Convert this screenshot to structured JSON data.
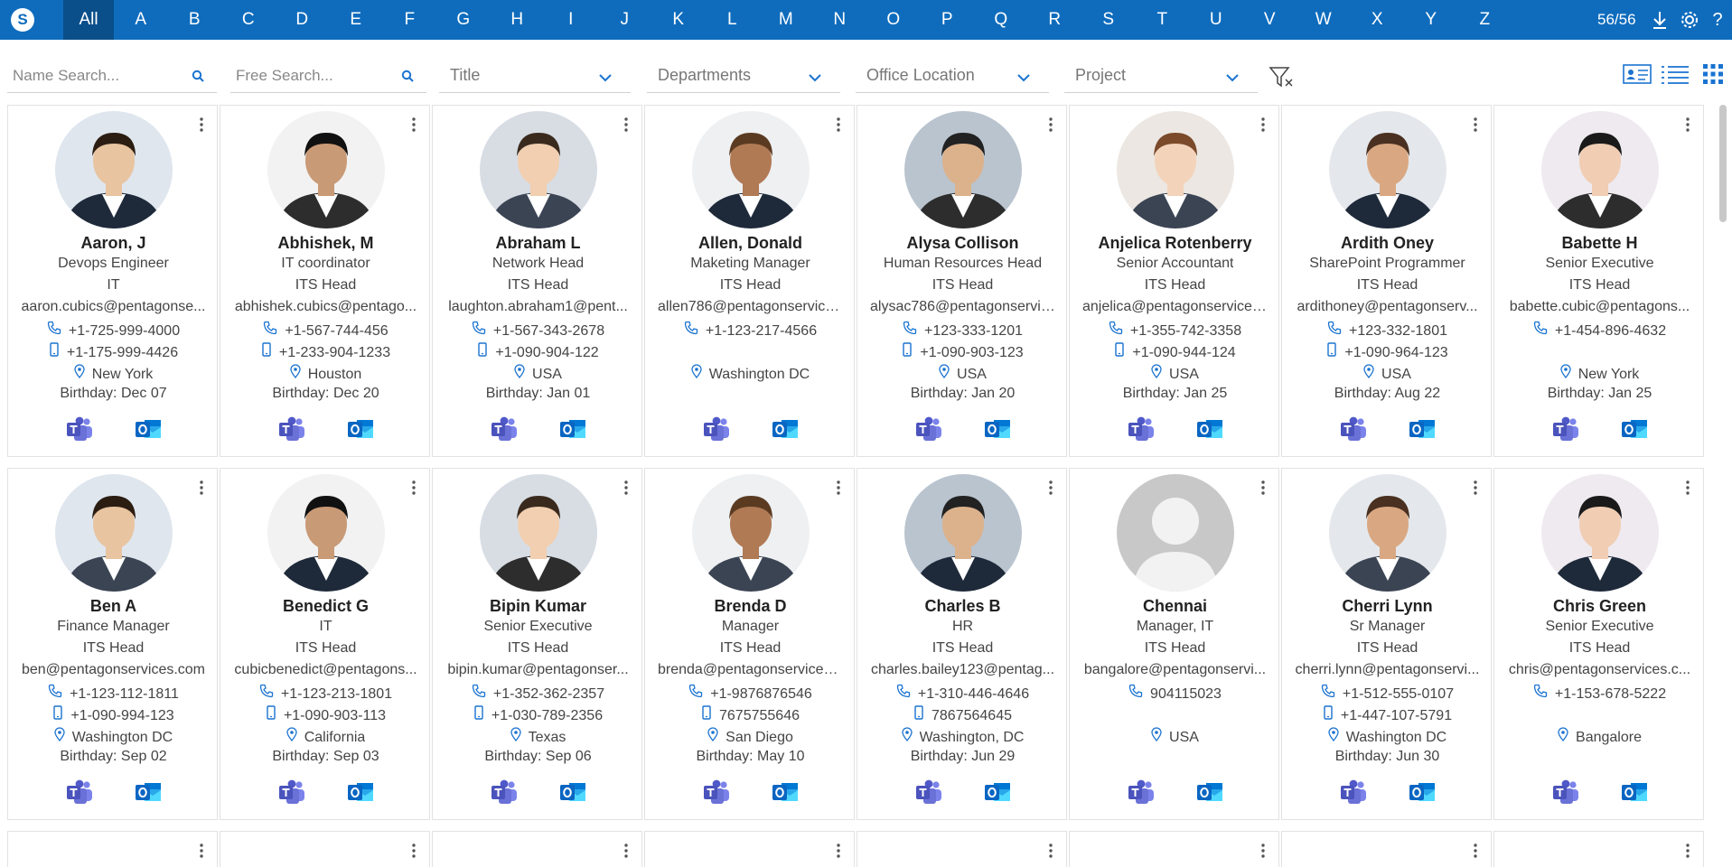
{
  "header": {
    "letters": [
      "All",
      "A",
      "B",
      "C",
      "D",
      "E",
      "F",
      "G",
      "H",
      "I",
      "J",
      "K",
      "L",
      "M",
      "N",
      "O",
      "P",
      "Q",
      "R",
      "S",
      "T",
      "U",
      "V",
      "W",
      "X",
      "Y",
      "Z"
    ],
    "active_letter": "All",
    "count": "56/56",
    "icons": [
      "app-logo-icon",
      "download-icon",
      "gear-icon",
      "help-icon"
    ]
  },
  "filters": {
    "name_search_placeholder": "Name Search...",
    "free_search_placeholder": "Free Search...",
    "title_label": "Title",
    "departments_label": "Departments",
    "office_location_label": "Office Location",
    "project_label": "Project"
  },
  "view_icons": [
    "card-view-icon",
    "list-view-icon",
    "grid-view-icon"
  ],
  "colors": {
    "accent": "#0f6cbd",
    "active_letter_bg": "#0a4e8a",
    "icon_blue": "#1a73d0",
    "teams": "#5059c9",
    "outlook": "#0a66c2"
  },
  "people": [
    {
      "name": "Aaron, J",
      "title": "Devops Engineer",
      "dept": "IT",
      "email": "aaron.cubics@pentagonse...",
      "phone": "+1-725-999-4000",
      "mobile": "+1-175-999-4426",
      "location": "New York",
      "birthday": "Birthday: Dec 07"
    },
    {
      "name": "Abhishek, M",
      "title": "IT coordinator",
      "dept": "ITS Head",
      "email": "abhishek.cubics@pentago...",
      "phone": "+1-567-744-456",
      "mobile": "+1-233-904-1233",
      "location": "Houston",
      "birthday": "Birthday: Dec 20"
    },
    {
      "name": "Abraham L",
      "title": "Network Head",
      "dept": "ITS Head",
      "email": "laughton.abraham1@pent...",
      "phone": "+1-567-343-2678",
      "mobile": "+1-090-904-122",
      "location": "USA",
      "birthday": "Birthday: Jan 01"
    },
    {
      "name": "Allen, Donald",
      "title": "Maketing Manager",
      "dept": "ITS Head",
      "email": "allen786@pentagonservice...",
      "phone": "+1-123-217-4566",
      "mobile": "",
      "location": "Washington DC",
      "birthday": ""
    },
    {
      "name": "Alysa Collison",
      "title": "Human Resources Head",
      "dept": "ITS Head",
      "email": "alysac786@pentagonservic...",
      "phone": "+123-333-1201",
      "mobile": "+1-090-903-123",
      "location": "USA",
      "birthday": "Birthday: Jan 20"
    },
    {
      "name": "Anjelica Rotenberry",
      "title": "Senior Accountant",
      "dept": "ITS Head",
      "email": "anjelica@pentagonservices...",
      "phone": "+1-355-742-3358",
      "mobile": "+1-090-944-124",
      "location": "USA",
      "birthday": "Birthday: Jan 25"
    },
    {
      "name": "Ardith Oney",
      "title": "SharePoint Programmer",
      "dept": "ITS Head",
      "email": "ardithoney@pentagonserv...",
      "phone": "+123-332-1801",
      "mobile": "+1-090-964-123",
      "location": "USA",
      "birthday": "Birthday: Aug 22"
    },
    {
      "name": "Babette H",
      "title": "Senior Executive",
      "dept": "ITS Head",
      "email": "babette.cubic@pentagons...",
      "phone": "+1-454-896-4632",
      "mobile": "",
      "location": "New York",
      "birthday": "Birthday: Jan 25"
    },
    {
      "name": "Ben A",
      "title": "Finance Manager",
      "dept": "ITS Head",
      "email": "ben@pentagonservices.com",
      "phone": "+1-123-112-1811",
      "mobile": "+1-090-994-123",
      "location": "Washington DC",
      "birthday": "Birthday: Sep 02"
    },
    {
      "name": "Benedict G",
      "title": "IT",
      "dept": "ITS Head",
      "email": "cubicbenedict@pentagons...",
      "phone": "+1-123-213-1801",
      "mobile": "+1-090-903-113",
      "location": "California",
      "birthday": "Birthday: Sep 03"
    },
    {
      "name": "Bipin Kumar",
      "title": "Senior Executive",
      "dept": "ITS Head",
      "email": "bipin.kumar@pentagonser...",
      "phone": "+1-352-362-2357",
      "mobile": "+1-030-789-2356",
      "location": "Texas",
      "birthday": "Birthday: Sep 06"
    },
    {
      "name": "Brenda D",
      "title": "Manager",
      "dept": "ITS Head",
      "email": "brenda@pentagonservices....",
      "phone": "+1-9876876546",
      "mobile": "7675755646",
      "location": "San Diego",
      "birthday": "Birthday: May 10"
    },
    {
      "name": "Charles B",
      "title": "HR",
      "dept": "ITS Head",
      "email": "charles.bailey123@pentag...",
      "phone": "+1-310-446-4646",
      "mobile": "7867564645",
      "location": "Washington, DC",
      "birthday": "Birthday: Jun 29"
    },
    {
      "name": "Chennai",
      "title": "Manager, IT",
      "dept": "ITS Head",
      "email": "bangalore@pentagonservi...",
      "phone": "904115023",
      "mobile": "",
      "location": "USA",
      "birthday": ""
    },
    {
      "name": "Cherri Lynn",
      "title": "Sr Manager",
      "dept": "ITS Head",
      "email": "cherri.lynn@pentagonservi...",
      "phone": "+1-512-555-0107",
      "mobile": "+1-447-107-5791",
      "location": "Washington DC",
      "birthday": "Birthday: Jun 30"
    },
    {
      "name": "Chris Green",
      "title": "Senior Executive",
      "dept": "ITS Head",
      "email": "chris@pentagonservices.c...",
      "phone": "+1-153-678-5222",
      "mobile": "",
      "location": "Bangalore",
      "birthday": ""
    }
  ]
}
